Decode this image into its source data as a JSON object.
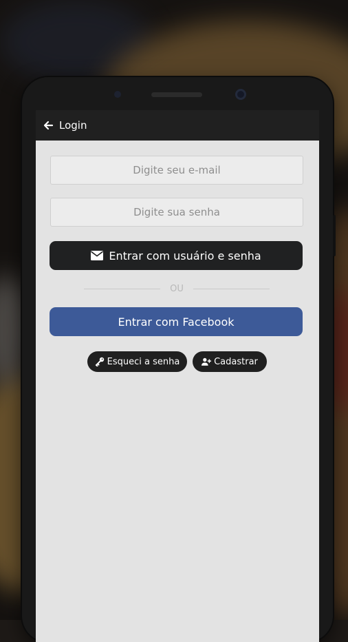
{
  "appbar": {
    "back_icon": "arrow-left-icon",
    "title": "Login"
  },
  "form": {
    "email_placeholder": "Digite seu e-mail",
    "password_placeholder": "Digite sua senha",
    "login_button": {
      "icon": "envelope-icon",
      "label": "Entrar com usuário e senha"
    },
    "separator": "OU",
    "facebook_button": {
      "label": "Entrar com Facebook",
      "color": "#3d5a98"
    }
  },
  "links": {
    "forgot": {
      "icon": "key-icon",
      "label": "Esqueci a senha"
    },
    "register": {
      "icon": "user-plus-icon",
      "label": "Cadastrar"
    }
  }
}
